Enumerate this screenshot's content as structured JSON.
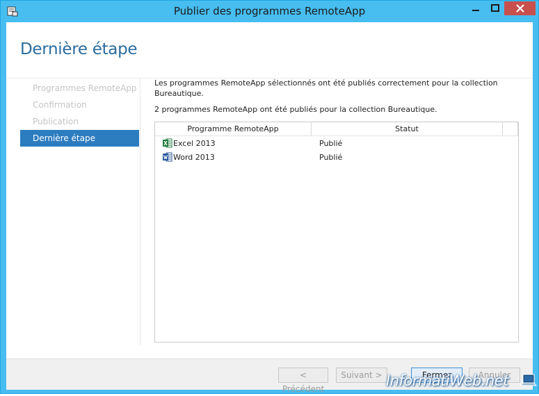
{
  "window": {
    "title": "Publier des programmes RemoteApp",
    "app_icon": "remoteapp-wizard-icon",
    "accent_color": "#47bdf0",
    "close_color": "#c7504c"
  },
  "header": {
    "title": "Dernière étape"
  },
  "nav": {
    "items": [
      {
        "label": "Programmes RemoteApp",
        "active": false
      },
      {
        "label": "Confirmation",
        "active": false
      },
      {
        "label": "Publication",
        "active": false
      },
      {
        "label": "Dernière étape",
        "active": true
      }
    ],
    "active_color": "#2c7cc0"
  },
  "content": {
    "message1": "Les programmes RemoteApp sélectionnés ont été publiés correctement pour la collection Bureautique.",
    "message2": "2 programmes RemoteApp ont été publiés pour la collection Bureautique.",
    "table": {
      "columns": [
        "Programme RemoteApp",
        "Statut"
      ],
      "rows": [
        {
          "program": "Excel 2013",
          "status": "Publié",
          "icon": "excel-icon"
        },
        {
          "program": "Word 2013",
          "status": "Publié",
          "icon": "word-icon"
        }
      ]
    }
  },
  "footer": {
    "previous_label": "< Précédent",
    "next_label": "Suivant >",
    "close_label": "Fermer",
    "cancel_label": "Annuler"
  },
  "watermark": {
    "text": "InformatiWeb.net"
  }
}
